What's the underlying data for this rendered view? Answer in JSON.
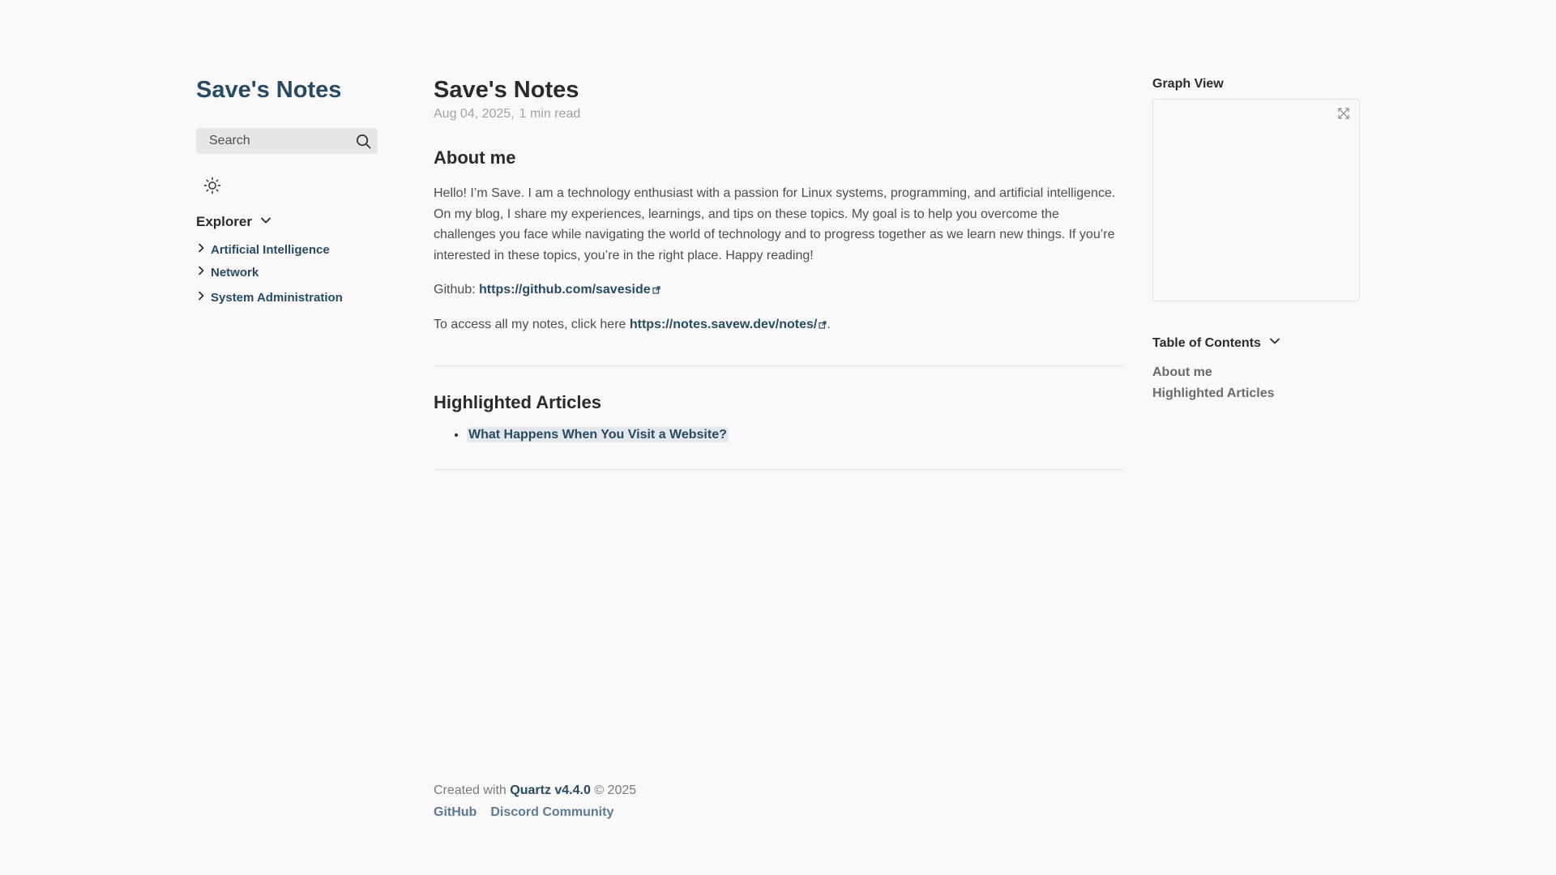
{
  "sidebar": {
    "site_title": "Save's Notes",
    "search_label": "Search",
    "explorer": {
      "title": "Explorer",
      "folders": [
        {
          "label": "Artificial Intelligence"
        },
        {
          "label": "Network"
        },
        {
          "label": "System Administration"
        }
      ]
    }
  },
  "article": {
    "title": "Save's Notes",
    "date": "Aug 04, 2025,",
    "read_time": "1 min read",
    "about_heading": "About me",
    "about_text": "Hello! I’m Save. I am a technology enthusiast with a passion for Linux systems, programming, and artificial intelligence. On my blog, I share my experiences, learnings, and tips on these topics. My goal is to help you overcome the challenges you face while navigating the world of technology and to progress together as we learn new things. If you’re interested in these topics, you’re in the right place. Happy reading!",
    "github_prefix": "Github: ",
    "github_link": "https://github.com/saveside",
    "notes_prefix": "To access all my notes, click here ",
    "notes_link": "https://notes.savew.dev/notes/",
    "notes_suffix": ".",
    "highlighted_heading": "Highlighted Articles",
    "highlighted": [
      {
        "label": "What Happens When You Visit a Website?"
      }
    ]
  },
  "footer": {
    "created_prefix": "Created with ",
    "quartz_link": "Quartz v4.4.0",
    "copyright": " © 2025",
    "links": [
      {
        "label": "GitHub"
      },
      {
        "label": "Discord Community"
      }
    ]
  },
  "right": {
    "graph_title": "Graph View",
    "toc_title": "Table of Contents",
    "toc_items": [
      {
        "label": "About me"
      },
      {
        "label": "Highlighted Articles"
      }
    ]
  },
  "colors": {
    "background": "#faf8f8",
    "accent": "#284b63",
    "text": "#2b2b2b",
    "muted": "#a3a3a3"
  },
  "icons": {
    "search": "search-icon",
    "theme": "sun-icon",
    "chevron": "chevron-right-icon",
    "collapse": "chevron-down-icon",
    "external": "external-link-icon",
    "graph_expand": "expand-icon"
  }
}
